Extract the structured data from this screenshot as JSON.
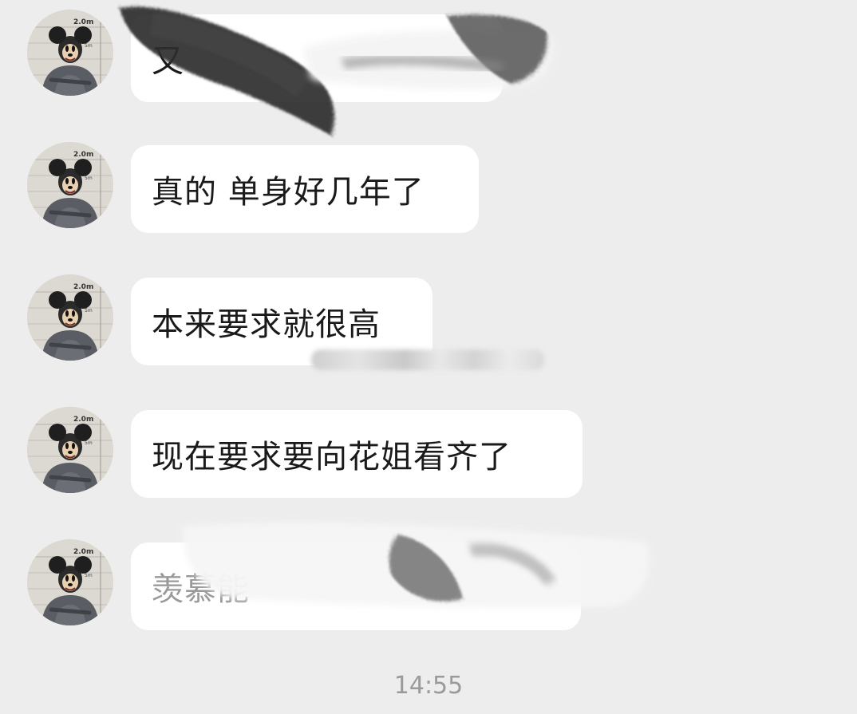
{
  "messages": [
    {
      "text": "又",
      "obscured": true
    },
    {
      "text": "真的 单身好几年了"
    },
    {
      "text": "本来要求就很高"
    },
    {
      "text": "现在要求要向花姐看齐了"
    },
    {
      "text": "羡慕能",
      "obscured": true
    }
  ],
  "timestamp": "14:55",
  "avatar_caption": "2.0m",
  "colors": {
    "background": "#ededed",
    "bubble": "#ffffff",
    "text": "#1a1a1a",
    "timestamp": "#9a9a9a"
  }
}
